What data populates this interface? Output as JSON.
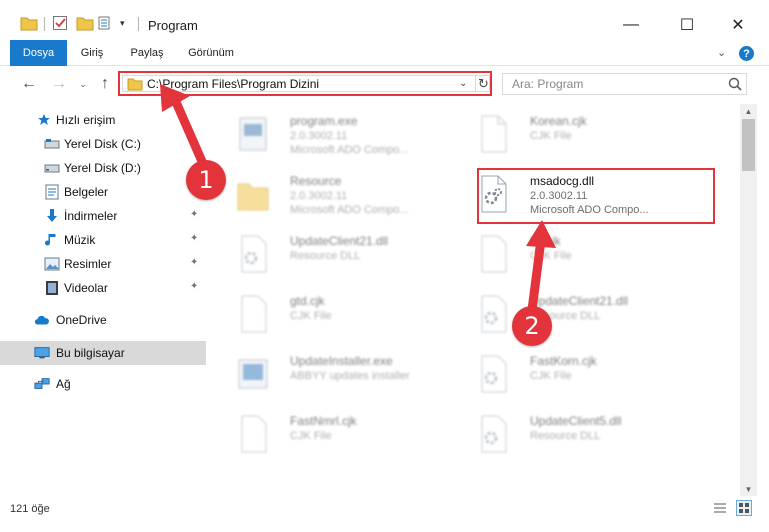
{
  "window": {
    "title": "Program",
    "minimize_glyph": "—",
    "maximize_glyph": "☐",
    "close_glyph": "✕"
  },
  "ribbon": {
    "tabs": [
      "Dosya",
      "Giriş",
      "Paylaş",
      "Görünüm"
    ],
    "expand_glyph": "⌄",
    "help_glyph": "?"
  },
  "nav": {
    "back_glyph": "←",
    "forward_glyph": "→",
    "recent_glyph": "⌄",
    "up_glyph": "↑"
  },
  "address": {
    "path": "C:\\Program Files\\Program Dizini",
    "dropdown_glyph": "⌄",
    "refresh_glyph": "↻"
  },
  "search": {
    "placeholder": "Ara: Program"
  },
  "sidebar": {
    "items": [
      {
        "label": "Hızlı erişim",
        "icon": "star-icon"
      },
      {
        "label": "Yerel Disk (C:)",
        "icon": "drive-icon",
        "pinned": true
      },
      {
        "label": "Yerel Disk (D:)",
        "icon": "drive-icon"
      },
      {
        "label": "Belgeler",
        "icon": "documents-icon",
        "pinned": true
      },
      {
        "label": "İndirmeler",
        "icon": "downloads-icon",
        "pinned": true
      },
      {
        "label": "Müzik",
        "icon": "music-icon",
        "pinned": true
      },
      {
        "label": "Resimler",
        "icon": "pictures-icon",
        "pinned": true
      },
      {
        "label": "Videolar",
        "icon": "videos-icon",
        "pinned": true
      },
      {
        "label": "OneDrive",
        "icon": "cloud-icon"
      },
      {
        "label": "Bu bilgisayar",
        "icon": "computer-icon",
        "selected": true
      },
      {
        "label": "Ağ",
        "icon": "network-icon"
      }
    ],
    "pin_glyph": "📌"
  },
  "files": [
    {
      "name": "program.exe",
      "type": "2.0.3002.11",
      "desc": "Microsoft ADO Compo...",
      "icon": "exe-icon"
    },
    {
      "name": "Korean.cjk",
      "type": "CJK File",
      "desc": "",
      "icon": "file-icon"
    },
    {
      "name": "Resource",
      "type": "2.0.3002.11",
      "desc": "Microsoft ADO Compo...",
      "icon": "folder-icon"
    },
    {
      "name": "msadocg.dll",
      "type": "2.0.3002.11",
      "desc": "Microsoft ADO Compo...",
      "icon": "dll-icon"
    },
    {
      "name": "UpdateClient21.dll",
      "type": "Resource DLL",
      "desc": "",
      "icon": "dll-icon"
    },
    {
      "name": "hk.cjk",
      "type": "CJK File",
      "desc": "",
      "icon": "file-icon"
    },
    {
      "name": "gtd.cjk",
      "type": "CJK File",
      "desc": "",
      "icon": "file-icon"
    },
    {
      "name": "UpdateClient21.dll",
      "type": "Resource DLL",
      "desc": "",
      "icon": "dll-icon"
    },
    {
      "name": "UpdateInstaller.exe",
      "type": "ABBYY updates installer",
      "desc": "",
      "icon": "installer-icon"
    },
    {
      "name": "FastKorn.cjk",
      "type": "CJK File",
      "desc": "",
      "icon": "dll-icon"
    },
    {
      "name": "FastNmrl.cjk",
      "type": "CJK File",
      "desc": "",
      "icon": "file-icon"
    },
    {
      "name": "UpdateClient5.dll",
      "type": "Resource DLL",
      "desc": "",
      "icon": "dll-icon"
    }
  ],
  "status": {
    "item_count": "121 öğe"
  },
  "annotations": {
    "badge_1": "1",
    "badge_2": "2",
    "color": "#e3333b"
  },
  "colors": {
    "accent": "#1979ca",
    "highlight": "#e3333b",
    "selected_bg": "#d9d9d9"
  }
}
